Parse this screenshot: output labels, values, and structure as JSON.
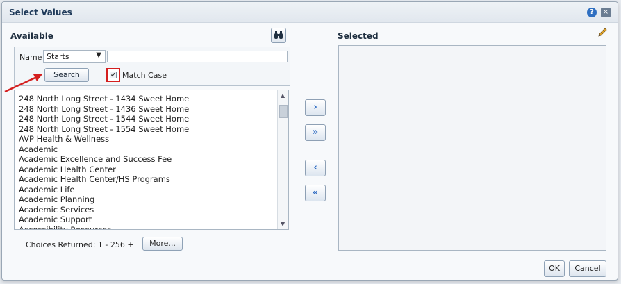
{
  "dialog": {
    "title": "Select Values",
    "available_label": "Available",
    "selected_label": "Selected"
  },
  "search": {
    "name_label": "Name",
    "operator_value": "Starts",
    "text_value": "",
    "search_button": "Search",
    "match_case_label": "Match Case",
    "match_case_checked": true
  },
  "available_items": [
    "248 North Long Street - 1434 Sweet Home",
    "248 North Long Street - 1436 Sweet Home",
    "248 North Long Street - 1544 Sweet Home",
    "248 North Long Street - 1554 Sweet Home",
    "AVP Health & Wellness",
    "Academic",
    "Academic Excellence and Success Fee",
    "Academic Health Center",
    "Academic Health Center/HS Programs",
    "Academic Life",
    "Academic Planning",
    "Academic Services",
    "Academic Support",
    "Accessibility Resources"
  ],
  "choices": {
    "label": "Choices Returned: 1 - 256 +",
    "more_button": "More..."
  },
  "shuttle": {
    "move": "›",
    "move_all": "»",
    "remove": "‹",
    "remove_all": "«"
  },
  "footer": {
    "ok": "OK",
    "cancel": "Cancel"
  },
  "icons": {
    "help": "?",
    "close": "×",
    "dropdown": "▼",
    "check": "✔"
  },
  "colors": {
    "accent": "#2e6bc2",
    "annotation_red": "#d41f1f",
    "title_text": "#1f3a5a"
  }
}
